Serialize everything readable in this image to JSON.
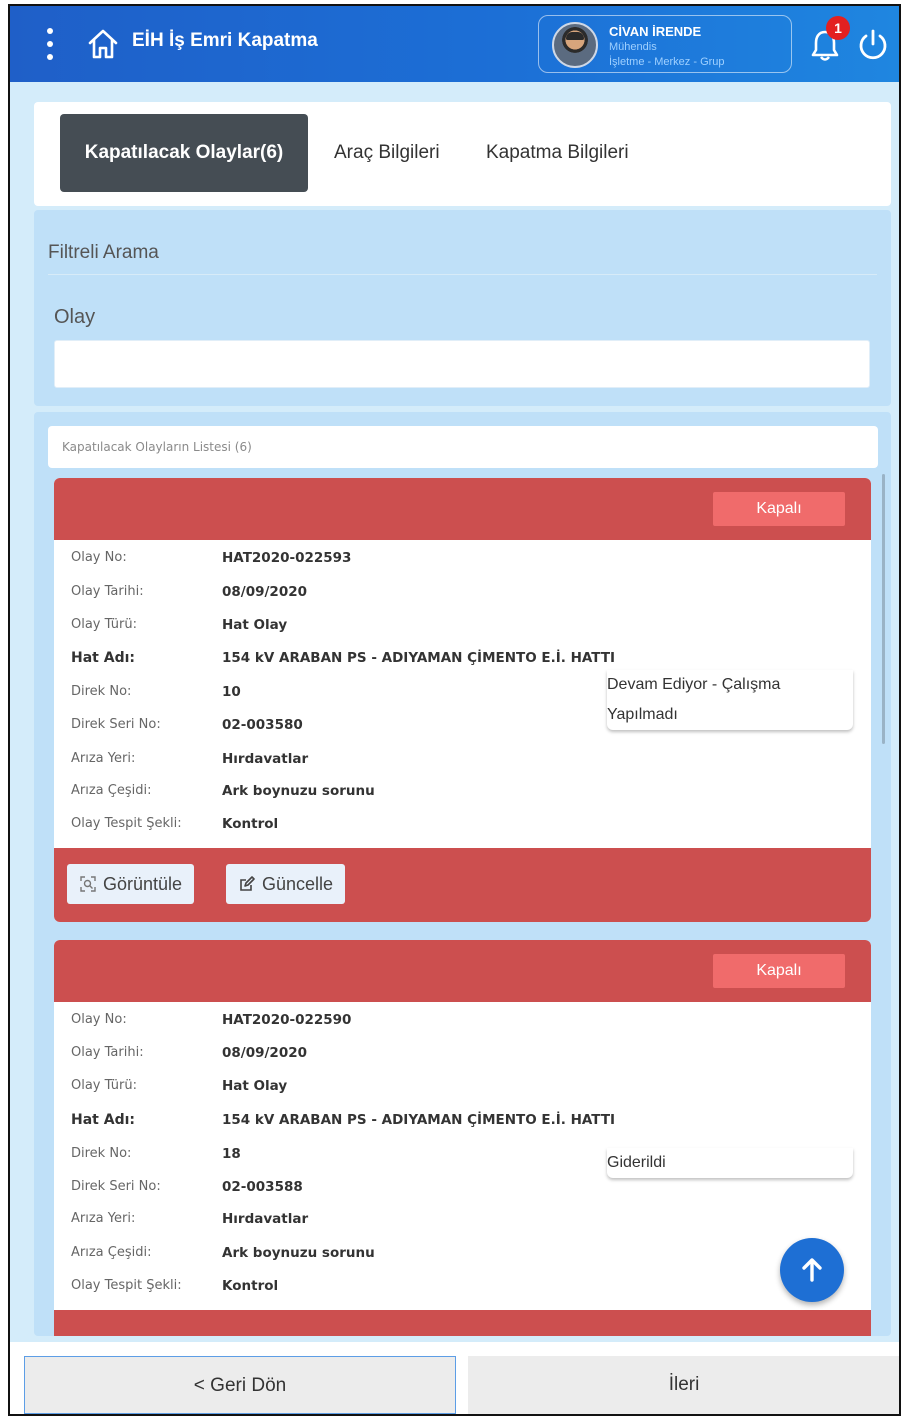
{
  "header": {
    "title": "EİH İş Emri Kapatma",
    "user": {
      "name": "CİVAN İRENDE",
      "role": "Mühendis",
      "department": "İşletme - Merkez - Grup"
    },
    "notification_count": "1"
  },
  "tabs": [
    {
      "label": "Kapatılacak Olaylar(6)",
      "active": true
    },
    {
      "label": "Araç Bilgileri",
      "active": false
    },
    {
      "label": "Kapatma Bilgileri",
      "active": false
    }
  ],
  "filter": {
    "title": "Filtreli Arama",
    "olay_label": "Olay",
    "olay_value": ""
  },
  "list": {
    "header": "Kapatılacak Olayların Listesi (6)",
    "cards": [
      {
        "status": "Kapalı",
        "fields": [
          {
            "label": "Olay No:",
            "value": "HAT2020-022593"
          },
          {
            "label": "Olay Tarihi:",
            "value": "08/09/2020"
          },
          {
            "label": "Olay Türü:",
            "value": "Hat Olay"
          },
          {
            "label": "Hat Adı:",
            "value": "154 kV ARABAN PS - ADIYAMAN ÇİMENTO E.İ. HATTI"
          },
          {
            "label": "Direk No:",
            "value": "10"
          },
          {
            "label": "Direk Seri No:",
            "value": "02-003580"
          },
          {
            "label": "Arıza Yeri:",
            "value": "Hırdavatlar"
          },
          {
            "label": "Arıza Çeşidi:",
            "value": "Ark boynuzu sorunu"
          },
          {
            "label": "Olay Tespit Şekli:",
            "value": "Kontrol"
          }
        ],
        "durum_line1": "Devam Ediyor - Çalışma",
        "durum_line2": "Yapılmadı",
        "view_label": "Görüntüle",
        "update_label": "Güncelle"
      },
      {
        "status": "Kapalı",
        "fields": [
          {
            "label": "Olay No:",
            "value": "HAT2020-022590"
          },
          {
            "label": "Olay Tarihi:",
            "value": "08/09/2020"
          },
          {
            "label": "Olay Türü:",
            "value": "Hat Olay"
          },
          {
            "label": "Hat Adı:",
            "value": "154 kV ARABAN PS - ADIYAMAN ÇİMENTO E.İ. HATTI"
          },
          {
            "label": "Direk No:",
            "value": "18"
          },
          {
            "label": "Direk Seri No:",
            "value": "02-003588"
          },
          {
            "label": "Arıza Yeri:",
            "value": "Hırdavatlar"
          },
          {
            "label": "Arıza Çeşidi:",
            "value": "Ark boynuzu sorunu"
          },
          {
            "label": "Olay Tespit Şekli:",
            "value": "Kontrol"
          }
        ],
        "durum_line1": "Giderildi"
      }
    ]
  },
  "bottom": {
    "back_label": "< Geri Dön",
    "next_label": "İleri"
  },
  "colors": {
    "header": "#1c6fd6",
    "card_accent": "#cc4f4f",
    "status_button": "#f06b6b",
    "active_tab": "#454d54",
    "fab": "#1e6fd4"
  }
}
